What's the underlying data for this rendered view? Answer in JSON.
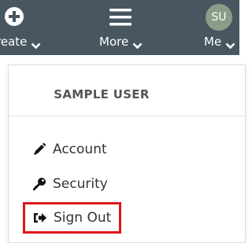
{
  "topbar": {
    "create": {
      "label": "reate",
      "icon": "plus-circle-icon"
    },
    "more": {
      "label": "More",
      "icon": "hamburger-menu-icon"
    },
    "me": {
      "label": "Me",
      "avatar_initials": "SU",
      "avatar_color": "#8a9e87"
    }
  },
  "dropdown": {
    "user_name": "SAMPLE USER",
    "items": [
      {
        "label": "Account",
        "icon": "pencil-icon"
      },
      {
        "label": "Security",
        "icon": "key-icon"
      },
      {
        "label": "Sign Out",
        "icon": "sign-out-icon",
        "highlighted": true
      }
    ]
  },
  "colors": {
    "topbar_bg": "#485660",
    "highlight_border": "#e0141b",
    "text_dark": "#333333"
  }
}
